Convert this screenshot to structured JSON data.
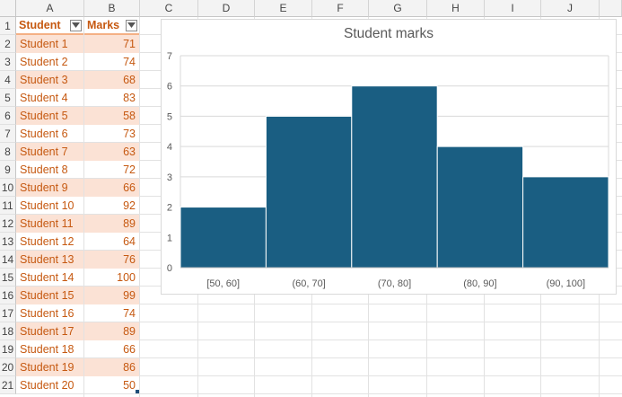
{
  "spreadsheet": {
    "columns": [
      "A",
      "B",
      "C",
      "D",
      "E",
      "F",
      "G",
      "H",
      "I",
      "J"
    ],
    "rows": [
      "1",
      "2",
      "3",
      "4",
      "5",
      "6",
      "7",
      "8",
      "9",
      "10",
      "11",
      "12",
      "13",
      "14",
      "15",
      "16",
      "17",
      "18",
      "19",
      "20",
      "21"
    ],
    "table": {
      "headers": [
        "Student",
        "Marks"
      ],
      "data": [
        [
          "Student 1",
          "71"
        ],
        [
          "Student 2",
          "74"
        ],
        [
          "Student 3",
          "68"
        ],
        [
          "Student 4",
          "83"
        ],
        [
          "Student 5",
          "58"
        ],
        [
          "Student 6",
          "73"
        ],
        [
          "Student 7",
          "63"
        ],
        [
          "Student 8",
          "72"
        ],
        [
          "Student 9",
          "66"
        ],
        [
          "Student 10",
          "92"
        ],
        [
          "Student 11",
          "89"
        ],
        [
          "Student 12",
          "64"
        ],
        [
          "Student 13",
          "76"
        ],
        [
          "Student 14",
          "100"
        ],
        [
          "Student 15",
          "99"
        ],
        [
          "Student 16",
          "74"
        ],
        [
          "Student 17",
          "89"
        ],
        [
          "Student 18",
          "66"
        ],
        [
          "Student 19",
          "86"
        ],
        [
          "Student 20",
          "50"
        ]
      ]
    }
  },
  "colors": {
    "bar": "#1a5e82",
    "table_text": "#c65911",
    "band": "#fbe2d5"
  },
  "chart_data": {
    "type": "bar",
    "title": "Student marks",
    "categories": [
      "[50, 60]",
      "(60, 70]",
      "(70, 80]",
      "(80, 90]",
      "(90, 100]"
    ],
    "values": [
      2,
      5,
      6,
      4,
      3
    ],
    "ylim": [
      0,
      7
    ],
    "yticks": [
      "0",
      "1",
      "2",
      "3",
      "4",
      "5",
      "6",
      "7"
    ],
    "grid": "horizontal",
    "legend": "none"
  }
}
